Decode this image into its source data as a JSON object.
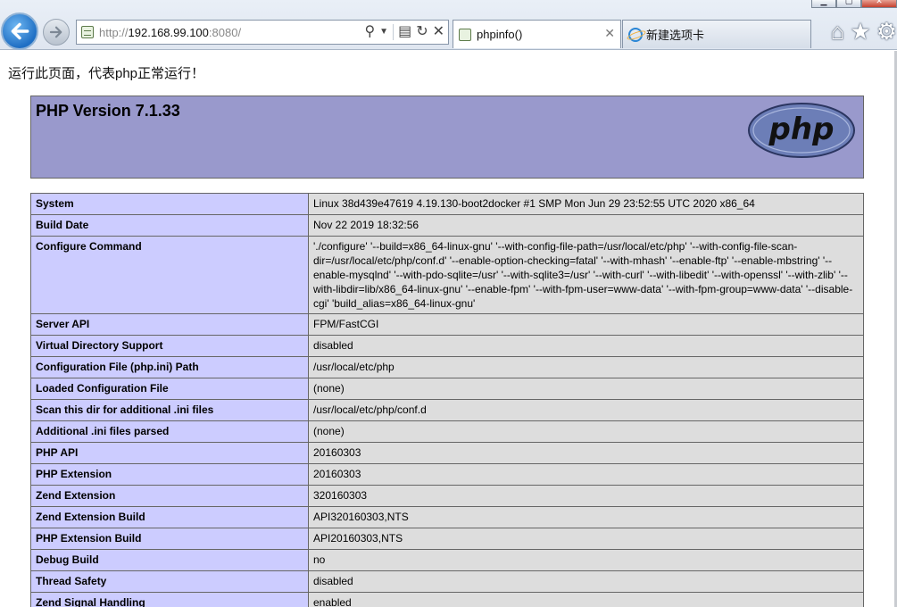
{
  "browser": {
    "url_scheme": "http://",
    "url_host": "192.168.99.100",
    "url_port": ":8080/",
    "tabs": [
      {
        "title": "phpinfo()",
        "active": true
      },
      {
        "title": "新建选项卡",
        "active": false
      }
    ]
  },
  "page": {
    "intro": "运行此页面，代表php正常运行！",
    "header": {
      "title": "PHP Version 7.1.33",
      "logo_text": "php"
    },
    "rows": [
      {
        "key": "System",
        "value": "Linux 38d439e47619 4.19.130-boot2docker #1 SMP Mon Jun 29 23:52:55 UTC 2020 x86_64"
      },
      {
        "key": "Build Date",
        "value": "Nov 22 2019 18:32:56"
      },
      {
        "key": "Configure Command",
        "value": "'./configure' '--build=x86_64-linux-gnu' '--with-config-file-path=/usr/local/etc/php' '--with-config-file-scan-dir=/usr/local/etc/php/conf.d' '--enable-option-checking=fatal' '--with-mhash' '--enable-ftp' '--enable-mbstring' '--enable-mysqlnd' '--with-pdo-sqlite=/usr' '--with-sqlite3=/usr' '--with-curl' '--with-libedit' '--with-openssl' '--with-zlib' '--with-libdir=lib/x86_64-linux-gnu' '--enable-fpm' '--with-fpm-user=www-data' '--with-fpm-group=www-data' '--disable-cgi' 'build_alias=x86_64-linux-gnu'"
      },
      {
        "key": "Server API",
        "value": "FPM/FastCGI"
      },
      {
        "key": "Virtual Directory Support",
        "value": "disabled"
      },
      {
        "key": "Configuration File (php.ini) Path",
        "value": "/usr/local/etc/php"
      },
      {
        "key": "Loaded Configuration File",
        "value": "(none)"
      },
      {
        "key": "Scan this dir for additional .ini files",
        "value": "/usr/local/etc/php/conf.d"
      },
      {
        "key": "Additional .ini files parsed",
        "value": "(none)"
      },
      {
        "key": "PHP API",
        "value": "20160303"
      },
      {
        "key": "PHP Extension",
        "value": "20160303"
      },
      {
        "key": "Zend Extension",
        "value": "320160303"
      },
      {
        "key": "Zend Extension Build",
        "value": "API320160303,NTS"
      },
      {
        "key": "PHP Extension Build",
        "value": "API20160303,NTS"
      },
      {
        "key": "Debug Build",
        "value": "no"
      },
      {
        "key": "Thread Safety",
        "value": "disabled"
      },
      {
        "key": "Zend Signal Handling",
        "value": "enabled"
      }
    ]
  },
  "colors": {
    "header_bg": "#9999cc",
    "key_cell_bg": "#ccccff",
    "value_cell_bg": "#dddddd"
  },
  "icons": [
    "back-arrow-icon",
    "forward-arrow-icon",
    "page-icon",
    "search-icon",
    "dropdown-icon",
    "compatibility-icon",
    "refresh-icon",
    "stop-icon",
    "ie-icon",
    "home-icon",
    "favorites-star-icon",
    "gear-icon"
  ]
}
